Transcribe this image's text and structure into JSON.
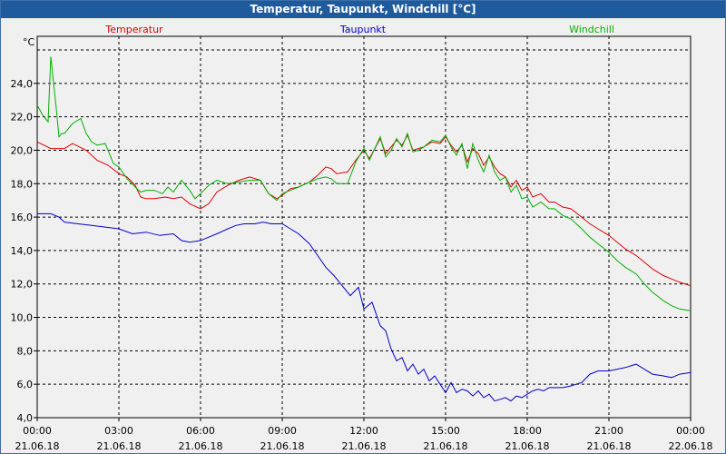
{
  "window": {
    "title": "Temperatur, Taupunkt, Windchill [°C]"
  },
  "colors": {
    "Temperatur": "#e00000",
    "Taupunkt": "#0000c8",
    "Windchill": "#00b000",
    "titlebar": "#1f5a9c"
  },
  "chart_data": {
    "type": "line",
    "title": "Temperatur, Taupunkt, Windchill [°C]",
    "ylabel": "°C",
    "ylim": [
      4.0,
      26.0
    ],
    "xlim_hours": [
      0,
      24
    ],
    "grid": true,
    "legend_placement": "top",
    "yticks": [
      "4,0",
      "6,0",
      "8,0",
      "10,0",
      "12,0",
      "14,0",
      "16,0",
      "18,0",
      "20,0",
      "22,0",
      "24,0"
    ],
    "xticks": [
      {
        "time": "00:00",
        "date": "21.06.18"
      },
      {
        "time": "03:00",
        "date": "21.06.18"
      },
      {
        "time": "06:00",
        "date": "21.06.18"
      },
      {
        "time": "09:00",
        "date": "21.06.18"
      },
      {
        "time": "12:00",
        "date": "21.06.18"
      },
      {
        "time": "15:00",
        "date": "21.06.18"
      },
      {
        "time": "18:00",
        "date": "21.06.18"
      },
      {
        "time": "21:00",
        "date": "21.06.18"
      },
      {
        "time": "00:00",
        "date": "22.06.18"
      }
    ],
    "series": [
      {
        "name": "Temperatur",
        "x": [
          0,
          0.5,
          1,
          1.3,
          1.8,
          2.2,
          2.6,
          3,
          3.3,
          3.6,
          3.8,
          4,
          4.3,
          4.7,
          5,
          5.3,
          5.6,
          6,
          6.3,
          6.6,
          7,
          7.4,
          7.8,
          8.2,
          8.5,
          8.8,
          9,
          9.3,
          9.6,
          10,
          10.3,
          10.6,
          10.8,
          11,
          11.4,
          11.7,
          12,
          12.2,
          12.4,
          12.6,
          12.8,
          13,
          13.2,
          13.4,
          13.6,
          13.8,
          14,
          14.2,
          14.5,
          14.8,
          15,
          15.2,
          15.4,
          15.6,
          15.8,
          16,
          16.2,
          16.4,
          16.6,
          16.8,
          17,
          17.2,
          17.4,
          17.6,
          17.8,
          18,
          18.2,
          18.5,
          18.8,
          19,
          19.3,
          19.6,
          20,
          20.3,
          20.6,
          21,
          21.3,
          21.6,
          22,
          22.3,
          22.6,
          23,
          23.3,
          23.6,
          24
        ],
        "values": [
          20.5,
          20.1,
          20.1,
          20.4,
          20.0,
          19.4,
          19.1,
          18.6,
          18.4,
          17.9,
          17.2,
          17.1,
          17.1,
          17.2,
          17.1,
          17.2,
          16.8,
          16.5,
          16.8,
          17.5,
          17.9,
          18.2,
          18.4,
          18.2,
          17.4,
          17.1,
          17.3,
          17.7,
          17.8,
          18.1,
          18.5,
          19.0,
          18.9,
          18.6,
          18.7,
          19.4,
          20.0,
          19.5,
          20.1,
          20.7,
          19.8,
          20.2,
          20.6,
          20.3,
          20.9,
          20.0,
          20.1,
          20.2,
          20.5,
          20.4,
          20.8,
          20.3,
          19.9,
          20.3,
          19.3,
          20.1,
          19.8,
          19.1,
          19.6,
          19.0,
          18.6,
          18.4,
          17.8,
          18.2,
          17.6,
          17.8,
          17.2,
          17.4,
          16.9,
          16.9,
          16.6,
          16.5,
          16.0,
          15.6,
          15.3,
          14.9,
          14.5,
          14.1,
          13.7,
          13.3,
          12.9,
          12.5,
          12.3,
          12.1,
          11.9
        ]
      },
      {
        "name": "Taupunkt",
        "x": [
          0,
          0.5,
          0.8,
          1,
          1.5,
          2,
          2.5,
          3,
          3.5,
          4,
          4.5,
          5,
          5.3,
          5.6,
          6,
          6.3,
          6.6,
          7,
          7.3,
          7.6,
          8,
          8.3,
          8.6,
          9,
          9.3,
          9.6,
          10,
          10.3,
          10.6,
          10.9,
          11.2,
          11.5,
          11.8,
          12,
          12.3,
          12.6,
          12.8,
          13,
          13.2,
          13.4,
          13.6,
          13.8,
          14,
          14.2,
          14.4,
          14.6,
          14.8,
          15,
          15.2,
          15.4,
          15.6,
          15.8,
          16,
          16.2,
          16.4,
          16.6,
          16.8,
          17,
          17.2,
          17.4,
          17.6,
          17.8,
          18,
          18.2,
          18.4,
          18.6,
          18.8,
          19,
          19.3,
          19.6,
          20,
          20.3,
          20.6,
          21,
          21.3,
          21.6,
          22,
          22.3,
          22.6,
          23,
          23.3,
          23.6,
          24
        ],
        "values": [
          16.2,
          16.2,
          16.0,
          15.7,
          15.6,
          15.5,
          15.4,
          15.3,
          15.0,
          15.1,
          14.9,
          15.0,
          14.6,
          14.5,
          14.6,
          14.8,
          15.0,
          15.3,
          15.5,
          15.6,
          15.6,
          15.7,
          15.6,
          15.6,
          15.3,
          15.0,
          14.4,
          13.7,
          13.0,
          12.5,
          11.9,
          11.3,
          11.8,
          10.5,
          10.9,
          9.5,
          9.2,
          8.1,
          7.4,
          7.6,
          6.8,
          7.2,
          6.6,
          6.9,
          6.2,
          6.5,
          6.0,
          5.5,
          6.1,
          5.5,
          5.7,
          5.6,
          5.3,
          5.6,
          5.2,
          5.4,
          5.0,
          5.1,
          5.2,
          5.0,
          5.3,
          5.2,
          5.4,
          5.6,
          5.7,
          5.6,
          5.8,
          5.8,
          5.8,
          5.9,
          6.1,
          6.6,
          6.8,
          6.8,
          6.9,
          7.0,
          7.2,
          6.9,
          6.6,
          6.5,
          6.4,
          6.6,
          6.7
        ]
      },
      {
        "name": "Windchill",
        "x": [
          0,
          0.2,
          0.4,
          0.5,
          0.7,
          0.8,
          0.9,
          1,
          1.3,
          1.6,
          1.8,
          2,
          2.2,
          2.5,
          2.8,
          3,
          3.3,
          3.6,
          3.8,
          4,
          4.3,
          4.6,
          4.8,
          5,
          5.3,
          5.6,
          5.8,
          6,
          6.3,
          6.6,
          7,
          7.4,
          7.8,
          8.2,
          8.5,
          8.8,
          9,
          9.3,
          9.6,
          10,
          10.3,
          10.6,
          10.8,
          11,
          11.4,
          11.7,
          12,
          12.2,
          12.4,
          12.6,
          12.8,
          13,
          13.2,
          13.4,
          13.6,
          13.8,
          14,
          14.2,
          14.5,
          14.8,
          15,
          15.2,
          15.4,
          15.6,
          15.8,
          16,
          16.2,
          16.4,
          16.6,
          16.8,
          17,
          17.2,
          17.4,
          17.6,
          17.8,
          18,
          18.2,
          18.5,
          18.8,
          19,
          19.3,
          19.6,
          20,
          20.3,
          20.6,
          21,
          21.3,
          21.6,
          22,
          22.3,
          22.6,
          23,
          23.3,
          23.6,
          24
        ],
        "values": [
          22.7,
          22.1,
          21.7,
          25.6,
          22.5,
          20.8,
          21.0,
          21.0,
          21.6,
          21.9,
          21.0,
          20.5,
          20.3,
          20.4,
          19.2,
          19.0,
          18.3,
          17.8,
          17.5,
          17.6,
          17.6,
          17.4,
          17.8,
          17.5,
          18.2,
          17.6,
          17.1,
          17.4,
          17.9,
          18.2,
          18.0,
          18.1,
          18.2,
          18.2,
          17.4,
          17.0,
          17.4,
          17.6,
          17.8,
          18.1,
          18.3,
          18.4,
          18.3,
          18.0,
          18.0,
          19.3,
          20.1,
          19.4,
          20.1,
          20.8,
          19.6,
          20.0,
          20.7,
          20.2,
          21.0,
          19.9,
          20.0,
          20.2,
          20.6,
          20.5,
          20.9,
          20.2,
          19.7,
          20.4,
          18.9,
          20.4,
          19.4,
          18.7,
          19.7,
          18.7,
          18.2,
          18.4,
          17.5,
          17.9,
          17.1,
          17.2,
          16.6,
          16.9,
          16.5,
          16.5,
          16.1,
          15.9,
          15.3,
          14.8,
          14.4,
          13.9,
          13.4,
          13.0,
          12.6,
          12.0,
          11.5,
          11.0,
          10.7,
          10.5,
          10.4
        ]
      }
    ]
  }
}
